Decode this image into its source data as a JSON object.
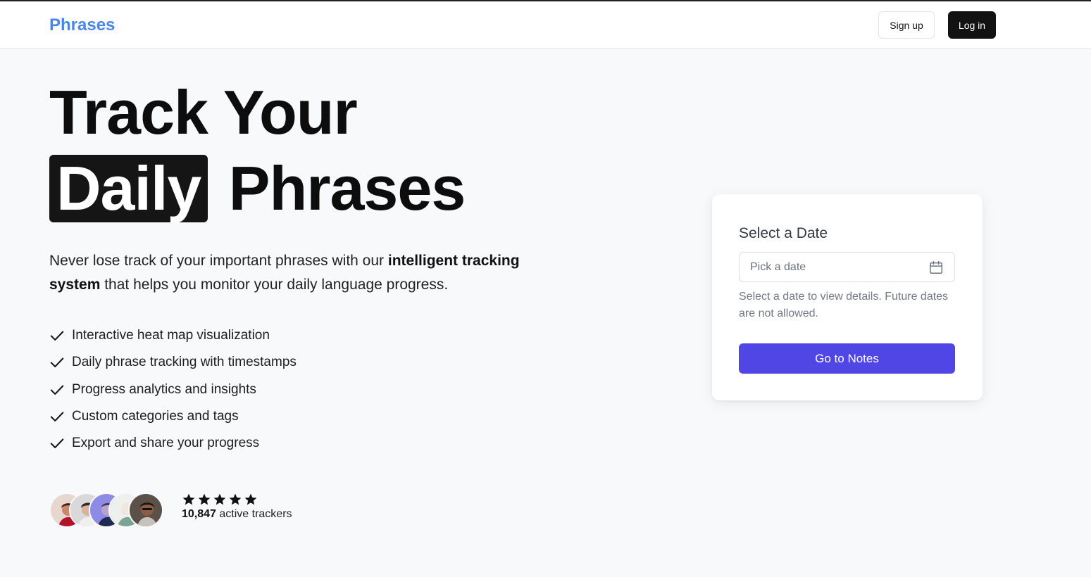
{
  "header": {
    "brand": "Phrases",
    "signup_label": "Sign up",
    "login_label": "Log in"
  },
  "hero": {
    "title_line1": "Track Your",
    "title_highlight": "Daily",
    "title_line2_rest": "Phrases",
    "description_part1": "Never lose track of your important phrases with our ",
    "description_bold": "intelligent tracking system",
    "description_part2": " that helps you monitor your daily language progress.",
    "features": [
      "Interactive heat map visualization",
      "Daily phrase tracking with timestamps",
      "Progress analytics and insights",
      "Custom categories and tags",
      "Export and share your progress"
    ],
    "rating": 5,
    "tracker_count": "10,847",
    "tracker_suffix": " active trackers"
  },
  "date_card": {
    "title": "Select a Date",
    "placeholder": "Pick a date",
    "hint": "Select a date to view details. Future dates are not allowed.",
    "button_label": "Go to Notes"
  },
  "colors": {
    "brand": "#4a86e8",
    "primary_button": "#4f46e5",
    "dark": "#121212",
    "background": "#f8f9fb"
  },
  "icons": {
    "feature": "check-icon",
    "rating": "star-icon",
    "date_input": "calendar-icon"
  }
}
